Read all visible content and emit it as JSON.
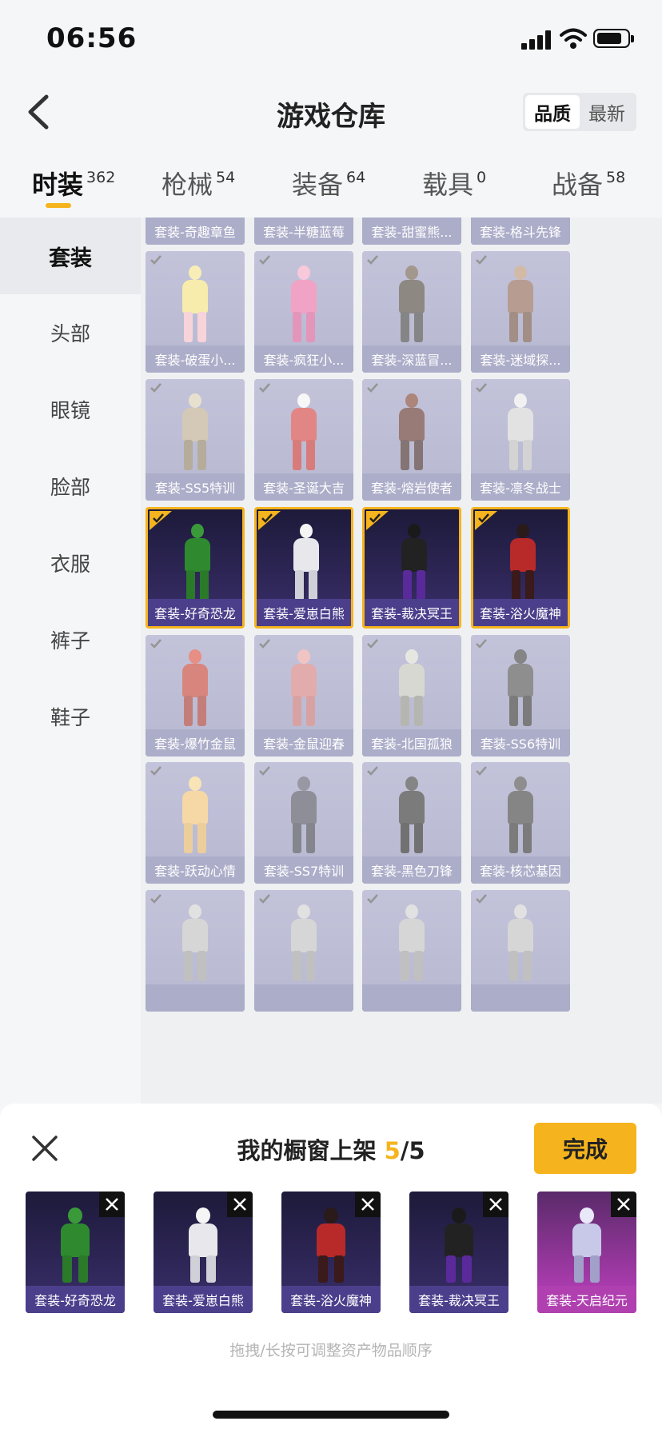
{
  "status_bar": {
    "time": "06:56"
  },
  "header": {
    "title": "游戏仓库",
    "sort_options": [
      "品质",
      "最新"
    ],
    "active_sort": "品质"
  },
  "tabs": [
    {
      "label": "时装",
      "count": "362",
      "active": true
    },
    {
      "label": "枪械",
      "count": "54",
      "active": false
    },
    {
      "label": "装备",
      "count": "64",
      "active": false
    },
    {
      "label": "载具",
      "count": "0",
      "active": false
    },
    {
      "label": "战备",
      "count": "58",
      "active": false
    }
  ],
  "sidebar": {
    "items": [
      "套装",
      "头部",
      "眼镜",
      "脸部",
      "衣服",
      "裤子",
      "鞋子"
    ],
    "active": "套装"
  },
  "grid": {
    "rows": [
      [
        "套装-奇趣章鱼",
        "套装-半糖蓝莓",
        "套装-甜蜜熊...",
        "套装-格斗先锋"
      ],
      [
        "套装-破蛋小...",
        "套装-疯狂小...",
        "套装-深蓝冒...",
        "套装-迷域探..."
      ],
      [
        "套装-SS5特训",
        "套装-圣诞大吉",
        "套装-熔岩使者",
        "套装-凛冬战士"
      ],
      [
        "套装-好奇恐龙",
        "套装-爱崽白熊",
        "套装-裁决冥王",
        "套装-浴火魔神"
      ],
      [
        "套装-爆竹金鼠",
        "套装-金鼠迎春",
        "套装-北国孤狼",
        "套装-SS6特训"
      ],
      [
        "套装-跃动心情",
        "套装-SS7特训",
        "套装-黑色刀锋",
        "套装-核芯基因"
      ],
      [
        "",
        "",
        "",
        ""
      ]
    ],
    "selected": [
      "套装-好奇恐龙",
      "套装-爱崽白熊",
      "套装-裁决冥王",
      "套装-浴火魔神"
    ]
  },
  "showcase": {
    "title": "我的橱窗上架",
    "count_current": "5",
    "count_sep": "/",
    "count_total": "5",
    "done_label": "完成",
    "items": [
      "套装-好奇恐龙",
      "套装-爱崽白熊",
      "套装-浴火魔神",
      "套装-裁决冥王",
      "套装-天启纪元"
    ],
    "hint": "拖拽/长按可调整资产物品顺序"
  },
  "colors": {
    "accent": "#f5b41e",
    "card": "#9e9fc3",
    "card_label": "#7a7ba8",
    "selected_bg": "#2a2450",
    "text": "#222222"
  }
}
